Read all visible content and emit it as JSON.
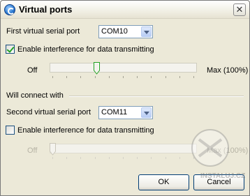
{
  "window": {
    "title": "Virtual ports",
    "close_glyph": "✕"
  },
  "port1": {
    "label": "First virtual serial port",
    "value": "COM10",
    "interference": {
      "label": "Enable interference for data transmitting",
      "checked": true,
      "slider": {
        "min_label": "Off",
        "max_label": "Max (100%)",
        "level": 0.31
      }
    }
  },
  "group": {
    "label": "Will connect with"
  },
  "port2": {
    "label": "Second virtual serial port",
    "value": "COM11",
    "interference": {
      "label": "Enable interference for data transmitting",
      "checked": false,
      "slider": {
        "min_label": "Off",
        "max_label": "Max (100%)",
        "level": 0.0
      }
    }
  },
  "buttons": {
    "ok": "OK",
    "cancel": "Cancel"
  },
  "watermark": {
    "text": "INSTALUJ.CZ"
  },
  "colors": {
    "dialog_bg": "#ece9d8",
    "check_mark": "#21a121",
    "button_border": "#003c74"
  }
}
